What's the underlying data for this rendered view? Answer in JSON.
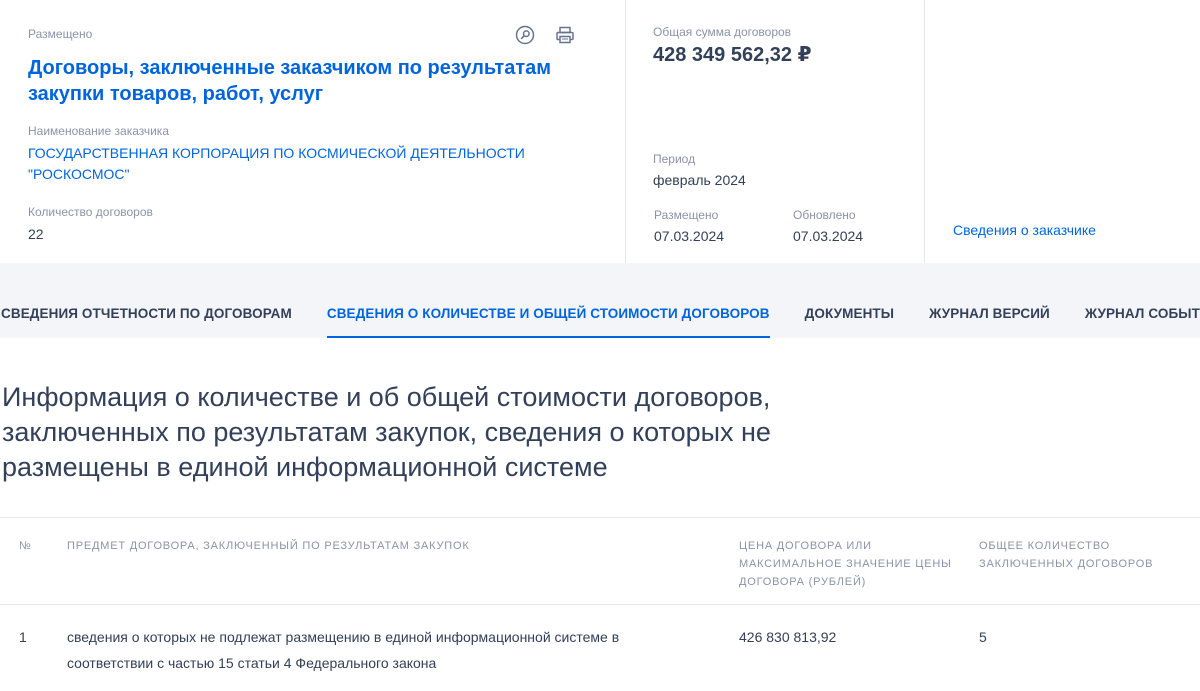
{
  "header": {
    "status": "Размещено",
    "title": "Договоры, заключенные заказчиком по результатам закупки товаров, работ, услуг",
    "customer_label": "Наименование заказчика",
    "customer_name": "ГОСУДАРСТВЕННАЯ КОРПОРАЦИЯ ПО КОСМИЧЕСКОЙ ДЕЯТЕЛЬНОСТИ \"РОСКОСМОС\"",
    "count_label": "Количество договоров",
    "count_value": "22",
    "icons": [
      "search-icon",
      "print-icon"
    ]
  },
  "summary": {
    "total_label": "Общая сумма договоров",
    "total_value": "428 349 562,32 ₽",
    "period_label": "Период",
    "period_value": "февраль 2024",
    "placed_label": "Размещено",
    "placed_value": "07.03.2024",
    "updated_label": "Обновлено",
    "updated_value": "07.03.2024"
  },
  "customer_link": "Сведения о заказчике",
  "tabs": [
    {
      "label": "СВЕДЕНИЯ ОТЧЕТНОСТИ ПО ДОГОВОРАМ",
      "active": false
    },
    {
      "label": "СВЕДЕНИЯ О КОЛИЧЕСТВЕ И ОБЩЕЙ СТОИМОСТИ ДОГОВОРОВ",
      "active": true
    },
    {
      "label": "ДОКУМЕНТЫ",
      "active": false
    },
    {
      "label": "ЖУРНАЛ ВЕРСИЙ",
      "active": false
    },
    {
      "label": "ЖУРНАЛ СОБЫТИЙ",
      "active": false
    }
  ],
  "section_heading": "Информация о количестве и об общей стоимости договоров, заключенных по результатам закупок, сведения о которых не размещены в единой информационной системе",
  "table": {
    "columns": [
      "№",
      "ПРЕДМЕТ ДОГОВОРА, ЗАКЛЮЧЕННЫЙ ПО РЕЗУЛЬТАТАМ ЗАКУПОК",
      "ЦЕНА ДОГОВОРА ИЛИ МАКСИМАЛЬНОЕ ЗНАЧЕНИЕ ЦЕНЫ ДОГОВОРА (РУБЛЕЙ)",
      "ОБЩЕЕ КОЛИЧЕСТВО ЗАКЛЮЧЕННЫХ ДОГОВОРОВ"
    ],
    "rows": [
      [
        "1",
        "сведения о которых не подлежат размещению в единой информационной системе в соответствии с частью 15 статьи 4 Федерального закона",
        "426 830 813,92",
        "5"
      ]
    ]
  },
  "colors": {
    "accent": "#0065dd",
    "text": "#334059",
    "muted": "#8a93a8",
    "band": "#f4f5f9"
  }
}
